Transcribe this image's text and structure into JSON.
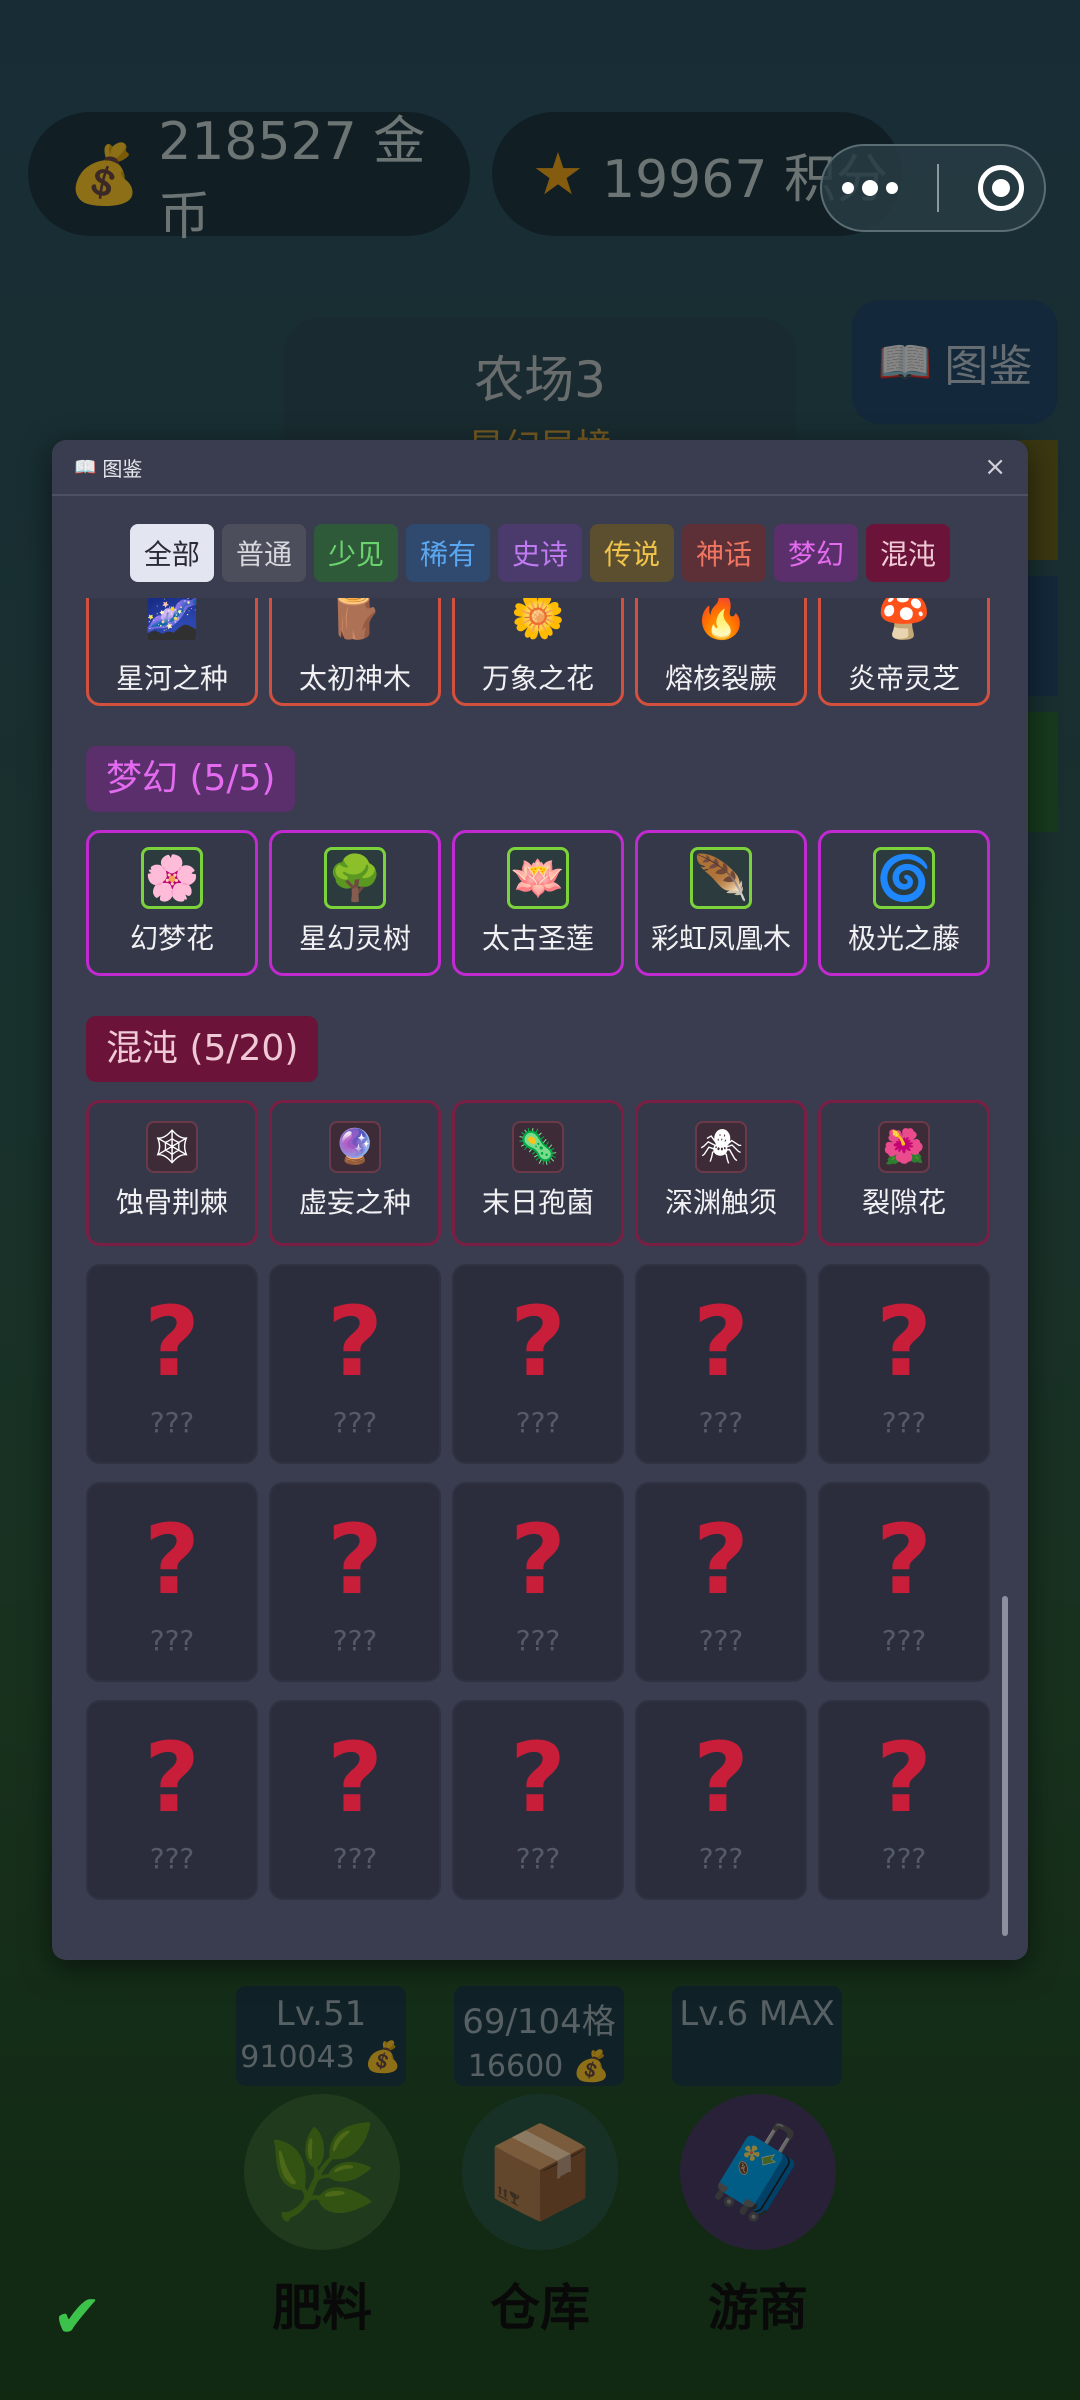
{
  "top": {
    "coins": "218527 金币",
    "points": "19967 积分"
  },
  "farm": {
    "title": "农场3",
    "subtitle": "星幻异境"
  },
  "atlas_button": "图鉴",
  "stats": {
    "level": "Lv.51",
    "level_cost": "910043",
    "space": "69/104格",
    "space_cost": "16600",
    "shop": "Lv.6 MAX"
  },
  "actions": {
    "fertilizer": "肥料",
    "storage": "仓库",
    "trader": "游商"
  },
  "modal": {
    "title": "图鉴",
    "close": "×",
    "filters": [
      {
        "label": "全部",
        "bg": "#e3e5f1",
        "fg": "#2a2b36"
      },
      {
        "label": "普通",
        "bg": "#4c4f5b",
        "fg": "#d7d8de"
      },
      {
        "label": "少见",
        "bg": "#2f5a3a",
        "fg": "#6bd36d"
      },
      {
        "label": "稀有",
        "bg": "#2f4a6e",
        "fg": "#5ba6f1"
      },
      {
        "label": "史诗",
        "bg": "#4b3a6c",
        "fg": "#c07af2"
      },
      {
        "label": "传说",
        "bg": "#5b4f2f",
        "fg": "#f0c34a"
      },
      {
        "label": "神话",
        "bg": "#5c3036",
        "fg": "#f07561"
      },
      {
        "label": "梦幻",
        "bg": "#5a2f6c",
        "fg": "#e46af0"
      },
      {
        "label": "混沌",
        "bg": "#6b1338",
        "fg": "#f0c9d6"
      }
    ],
    "myth_items": [
      {
        "name": "星河之种",
        "icon": "🌌"
      },
      {
        "name": "太初神木",
        "icon": "🪵"
      },
      {
        "name": "万象之花",
        "icon": "🌼"
      },
      {
        "name": "熔核裂蕨",
        "icon": "🔥"
      },
      {
        "name": "炎帝灵芝",
        "icon": "🍄"
      }
    ],
    "dream_section": "梦幻 (5/5)",
    "dream_items": [
      {
        "name": "幻梦花",
        "icon": "🌸"
      },
      {
        "name": "星幻灵树",
        "icon": "🌳"
      },
      {
        "name": "太古圣莲",
        "icon": "🪷"
      },
      {
        "name": "彩虹凤凰木",
        "icon": "🪶"
      },
      {
        "name": "极光之藤",
        "icon": "🌀"
      }
    ],
    "chaos_section": "混沌 (5/20)",
    "chaos_items": [
      {
        "name": "蚀骨荆棘",
        "icon": "🕸"
      },
      {
        "name": "虚妄之种",
        "icon": "🔮"
      },
      {
        "name": "末日孢菌",
        "icon": "🦠"
      },
      {
        "name": "深渊触须",
        "icon": "🕷"
      },
      {
        "name": "裂隙花",
        "icon": "🌺"
      }
    ],
    "unknown_mark": "?",
    "unknown_label": "???",
    "unknown_count": 15
  }
}
